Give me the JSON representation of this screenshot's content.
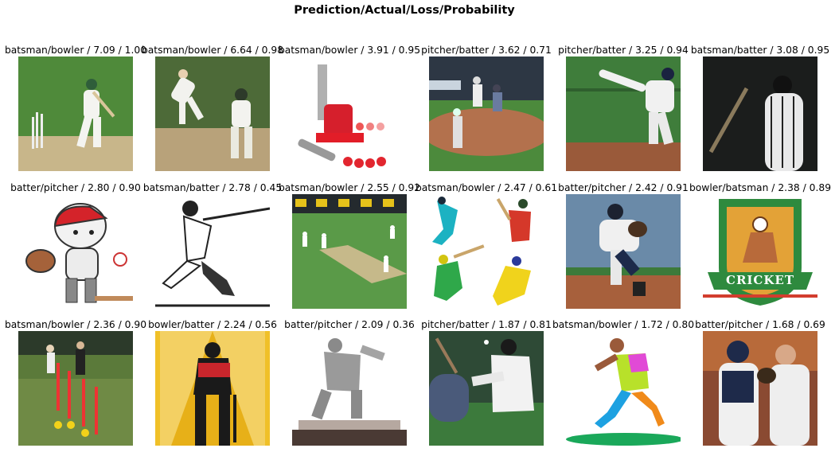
{
  "figure": {
    "title": "Prediction/Actual/Loss/Probability",
    "panels": [
      {
        "label": "batsman/bowler / 7.09 / 1.00",
        "scene": "cricket-batsman-bowled"
      },
      {
        "label": "batsman/bowler / 6.64 / 0.98",
        "scene": "cricket-bowler-and-batsman"
      },
      {
        "label": "batsman/bowler / 3.91 / 0.95",
        "scene": "bowling-machine-toy"
      },
      {
        "label": "pitcher/batter / 3.62 / 0.71",
        "scene": "baseball-stadium-at-bat"
      },
      {
        "label": "pitcher/batter / 3.25 / 0.94",
        "scene": "baseball-pitcher-throwing"
      },
      {
        "label": "batsman/batter / 3.08 / 0.95",
        "scene": "baseball-batter-dark"
      },
      {
        "label": "batter/pitcher / 2.80 / 0.90",
        "scene": "cartoon-boy-catcher"
      },
      {
        "label": "batsman/batter / 2.78 / 0.45",
        "scene": "sketch-batter-swing"
      },
      {
        "label": "batsman/bowler / 2.55 / 0.92",
        "scene": "cricket-field-wide"
      },
      {
        "label": "batsman/bowler / 2.47 / 0.61",
        "scene": "cricket-player-illustrations"
      },
      {
        "label": "batter/pitcher / 2.42 / 0.91",
        "scene": "baseball-pitcher-windup"
      },
      {
        "label": "bowler/batsman / 2.38 / 0.89",
        "scene": "cricket-badge",
        "badge_text": "CRICKET"
      },
      {
        "label": "batsman/bowler / 2.36 / 0.90",
        "scene": "cricket-training-poles"
      },
      {
        "label": "bowler/batter / 2.24 / 0.56",
        "scene": "batter-silhouette-poster"
      },
      {
        "label": "batter/pitcher / 2.09 / 0.36",
        "scene": "pitcher-trophy"
      },
      {
        "label": "pitcher/batter / 1.87 / 0.81",
        "scene": "baseball-pitch-closeup"
      },
      {
        "label": "batsman/bowler / 1.72 / 0.80",
        "scene": "colorful-runner-illustration"
      },
      {
        "label": "batter/pitcher / 1.68 / 0.69",
        "scene": "catcher-and-pitcher-talking"
      }
    ]
  }
}
